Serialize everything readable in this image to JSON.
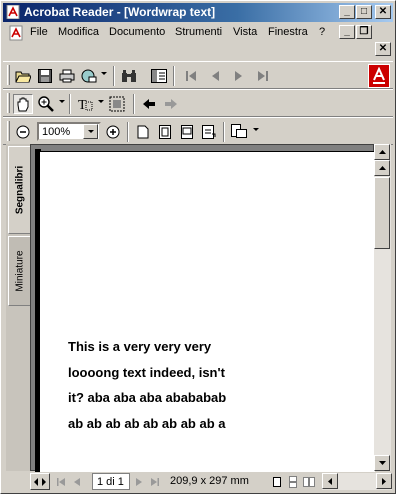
{
  "window": {
    "title": "Acrobat Reader - [Wordwrap text]",
    "minimize_label": "_",
    "maximize_label": "□",
    "close_label": "✕"
  },
  "menu": {
    "items": [
      {
        "label": "File"
      },
      {
        "label": "Modifica"
      },
      {
        "label": "Documento"
      },
      {
        "label": "Strumenti"
      },
      {
        "label": "Vista"
      },
      {
        "label": "Finestra"
      },
      {
        "label": "?"
      }
    ],
    "doc_minimize_label": "_",
    "doc_restore_label": "❐",
    "doc_close_label": "✕"
  },
  "toolbar": {
    "zoom_value": "100%"
  },
  "navigation_tabs": [
    {
      "label": "Segnalibri"
    },
    {
      "label": "Miniature"
    }
  ],
  "document": {
    "lines": [
      "This is a very very very",
      "loooong text indeed, isn't",
      "it? aba aba aba abababab",
      "ab ab ab ab ab ab ab ab a"
    ]
  },
  "status": {
    "page_indicator": "1 di 1",
    "page_size": "209,9 x 297 mm"
  },
  "colors": {
    "titlebar_start": "#0a246a",
    "titlebar_end": "#a6caf0",
    "adobe_red": "#cc0000",
    "chrome": "#d4d0c8"
  }
}
